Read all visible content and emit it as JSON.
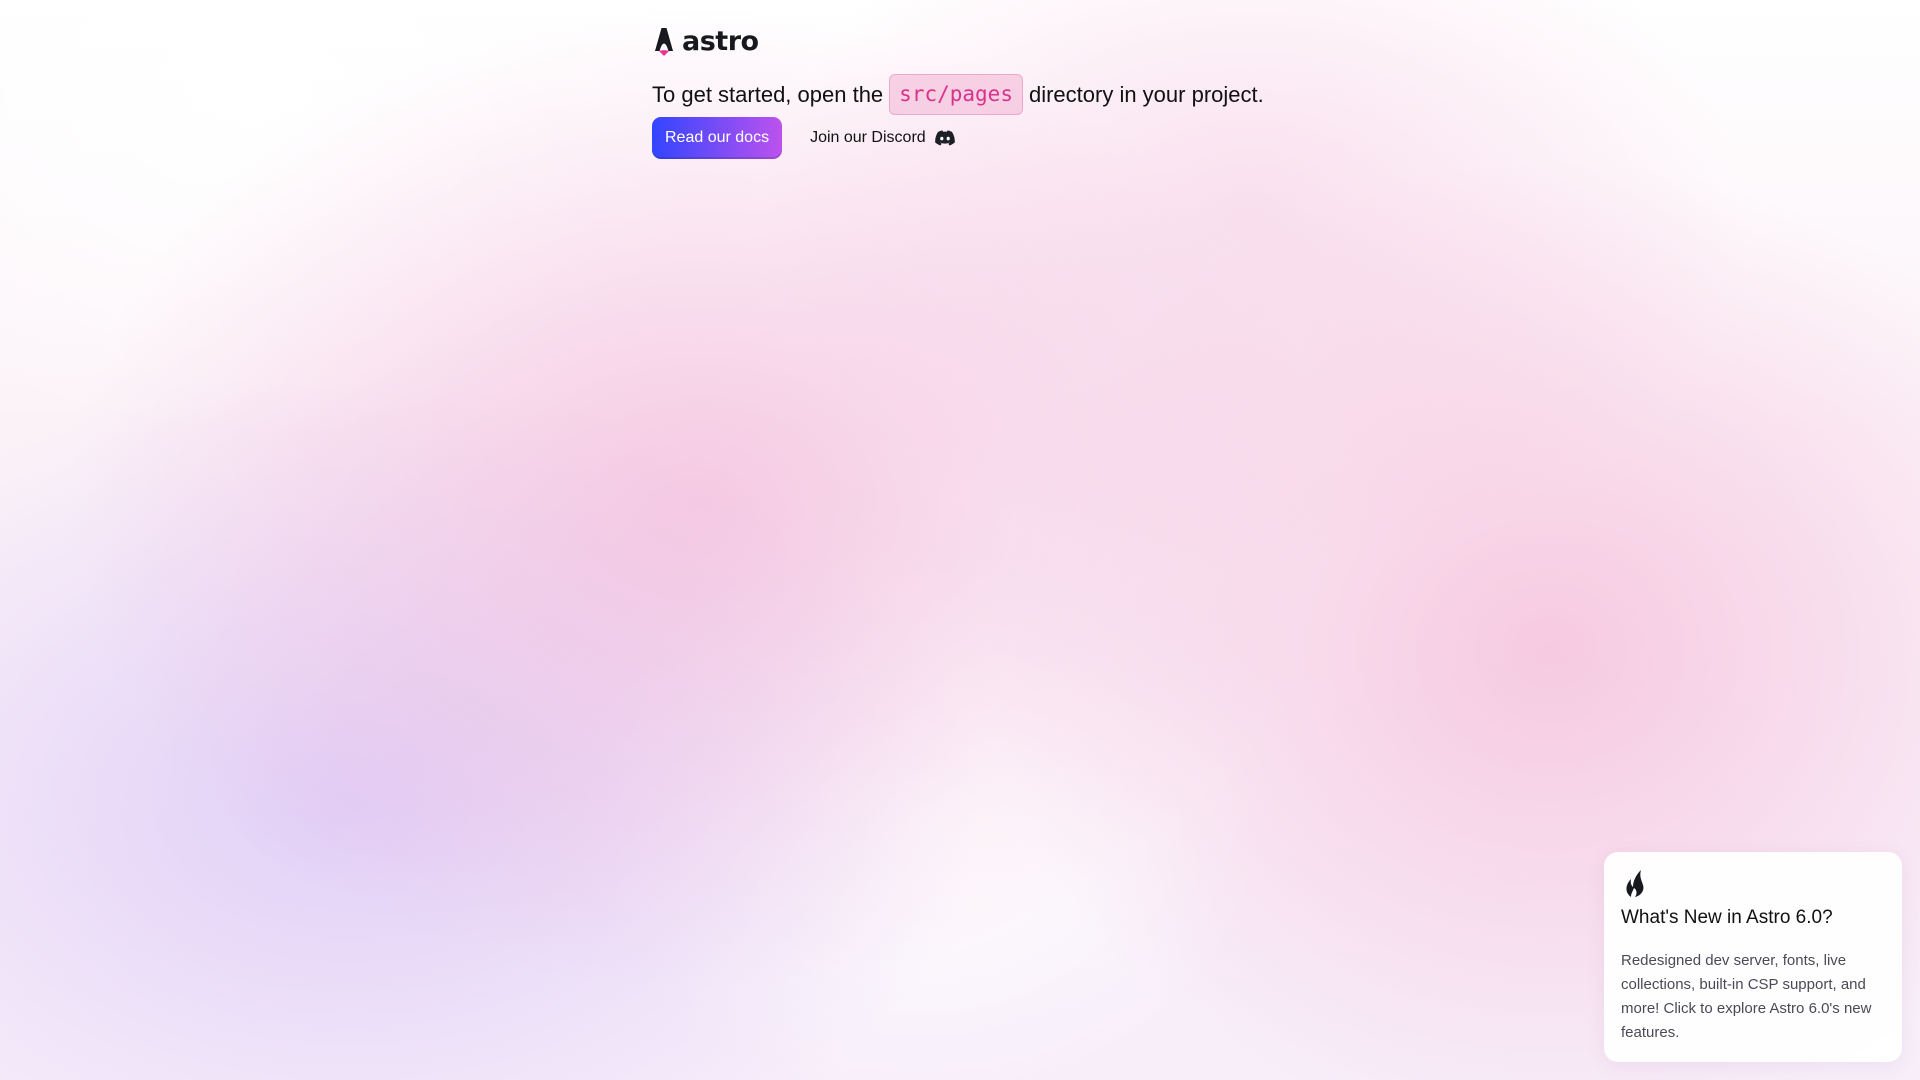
{
  "brand": {
    "wordmark": "astro",
    "accent": "#d6338a"
  },
  "intro": {
    "before": "To get started, open the",
    "code": "src/pages",
    "after": "directory in your project."
  },
  "actions": {
    "docs_label": "Read our docs",
    "discord_label": "Join our Discord",
    "discord_icon": "discord-icon"
  },
  "colors": {
    "button_start": "#3245ff",
    "button_end": "#bc52ee"
  },
  "news": {
    "icon": "flame-icon",
    "title": "What's New in Astro 6.0?",
    "body": "Redesigned dev server, fonts, live collections, built-in CSP support, and more! Click to explore Astro 6.0's new features."
  }
}
